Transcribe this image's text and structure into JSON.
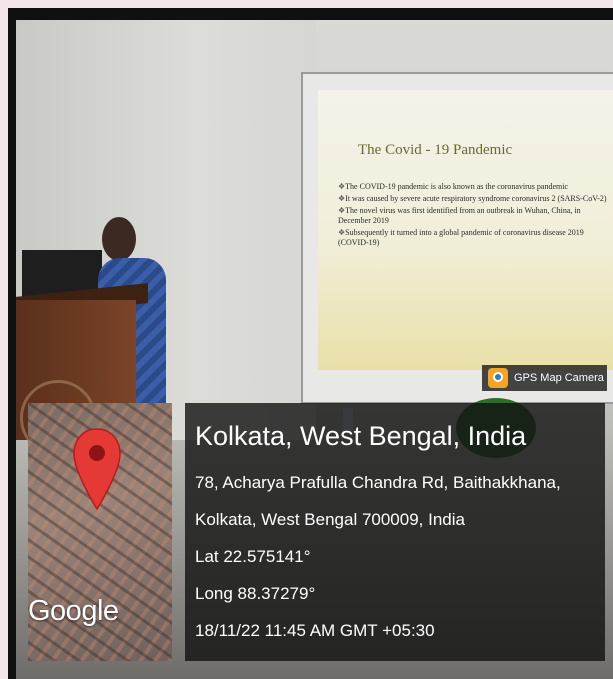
{
  "badge": {
    "label": "GPS Map Camera"
  },
  "slide": {
    "title": "The Covid - 19 Pandemic",
    "bullets": [
      "The COVID-19 pandemic is also known as the coronavirus pandemic",
      "It was caused by severe acute respiratory syndrome coronavirus 2 (SARS-CoV-2)",
      "The novel virus was first identified from an outbreak in Wuhan, China, in December 2019",
      "Subsequently it turned into a global pandemic of coronavirus disease 2019 (COVID-19)"
    ]
  },
  "stamp": {
    "map_brand": "Google",
    "city": "Kolkata, West Bengal, India",
    "address_line1": "78, Acharya Prafulla Chandra Rd, Baithakkhana,",
    "address_line2": "Kolkata, West Bengal 700009, India",
    "latitude": "Lat 22.575141°",
    "longitude": "Long 88.37279°",
    "datetime": "18/11/22 11:45 AM GMT +05:30"
  },
  "colors": {
    "pin": "#e53935",
    "overlay": "#121212",
    "slide_title": "#6a6a2e"
  }
}
